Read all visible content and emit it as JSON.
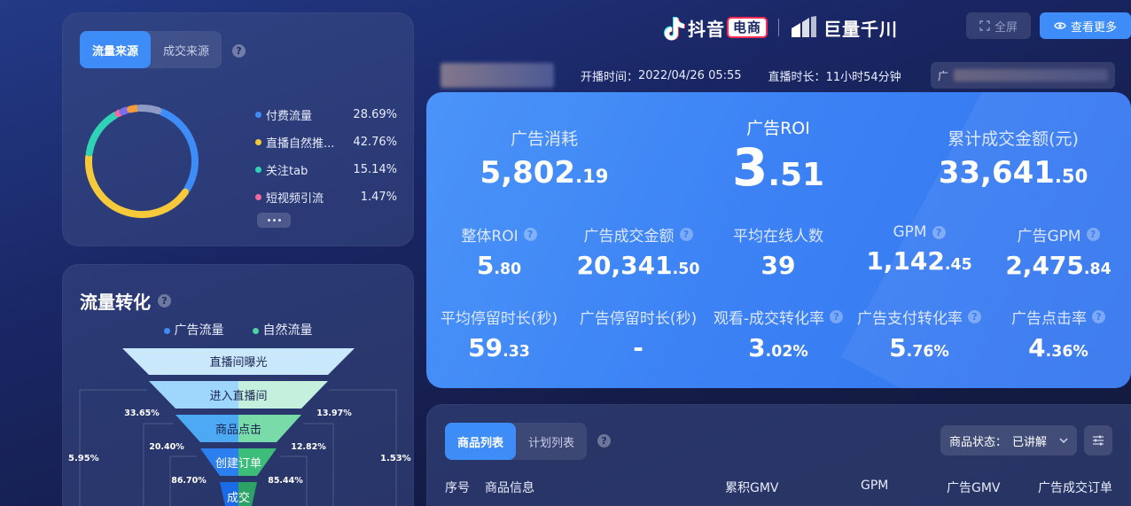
{
  "traffic_source": {
    "tabs": [
      "流量来源",
      "成交来源"
    ],
    "legend": [
      {
        "label": "付费流量",
        "value": "28.69%",
        "color": "#3d8cf7",
        "pct": 28.69
      },
      {
        "label": "直播自然推...",
        "value": "42.76%",
        "color": "#f6c93b",
        "pct": 42.76
      },
      {
        "label": "关注tab",
        "value": "15.14%",
        "color": "#2fd2b4",
        "pct": 15.14
      },
      {
        "label": "短视频引流",
        "value": "1.47%",
        "color": "#f06a9b",
        "pct": 1.47
      }
    ]
  },
  "funnel": {
    "title": "流量转化",
    "legend": [
      {
        "label": "广告流量",
        "color": "#3d8cf7"
      },
      {
        "label": "自然流量",
        "color": "#4fd3a0"
      }
    ],
    "stages": [
      "直播间曝光",
      "进入直播间",
      "商品点击",
      "创建订单",
      "成交"
    ],
    "left_rates": [
      "33.65%",
      "20.40%",
      "86.70%"
    ],
    "right_rates": [
      "13.97%",
      "12.82%",
      "85.44%"
    ],
    "side_left": "5.95%",
    "side_right": "1.53%"
  },
  "header": {
    "brand1": "抖音",
    "brand1_box": "电商",
    "brand2": "巨量千川",
    "fullscreen": "全屏",
    "view_more": "查看更多",
    "start_label": "开播时间：",
    "start_time": "2022/04/26 05:55",
    "duration_label": "直播时长：",
    "duration": "11小时54分钟",
    "search_prefix": "广"
  },
  "metrics_top": [
    {
      "label": "广告消耗",
      "int": "5,802",
      "dec": ".19"
    },
    {
      "label": "广告ROI",
      "int": "3",
      "dec": ".51"
    },
    {
      "label": "累计成交金额(元)",
      "int": "33,641",
      "dec": ".50"
    }
  ],
  "metrics_row1": [
    {
      "label": "整体ROI",
      "int": "5",
      "dec": ".80"
    },
    {
      "label": "广告成交金额",
      "int": "20,341",
      "dec": ".50"
    },
    {
      "label": "平均在线人数",
      "int": "39",
      "dec": ""
    },
    {
      "label": "GPM",
      "int": "1,142",
      "dec": ".45"
    },
    {
      "label": "广告GPM",
      "int": "2,475",
      "dec": ".84"
    }
  ],
  "metrics_row2": [
    {
      "label": "平均停留时长(秒)",
      "int": "59",
      "dec": ".33"
    },
    {
      "label": "广告停留时长(秒)",
      "int": "-",
      "dec": ""
    },
    {
      "label": "观看-成交转化率",
      "int": "3",
      "dec": ".02%"
    },
    {
      "label": "广告支付转化率",
      "int": "5",
      "dec": ".76%"
    },
    {
      "label": "广告点击率",
      "int": "4",
      "dec": ".36%"
    }
  ],
  "products": {
    "tabs": [
      "商品列表",
      "计划列表"
    ],
    "status_label": "商品状态：",
    "status_value": "已讲解",
    "columns": [
      "序号",
      "商品信息",
      "累积GMV",
      "GPM",
      "广告GMV",
      "广告成交订单"
    ]
  }
}
